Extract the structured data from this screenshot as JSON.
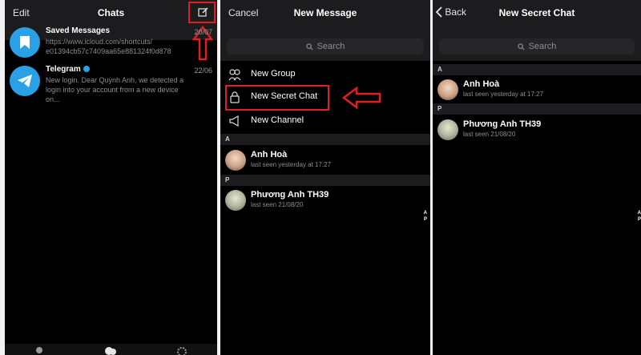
{
  "chats": {
    "edit_label": "Edit",
    "title": "Chats",
    "items": [
      {
        "title": "Saved Messages",
        "date": "20/07",
        "preview": "https://www.icloud.com/shortcuts/ e01394cb57c7409aa65e881324f0d878"
      },
      {
        "title": "Telegram",
        "date": "22/06",
        "preview": "New login. Dear Quỳnh Anh, we detected a login into your account from a new device on..."
      }
    ],
    "tabs": [
      "contacts-icon",
      "chats-icon",
      "settings-icon"
    ]
  },
  "new_message": {
    "cancel_label": "Cancel",
    "title": "New Message",
    "search_placeholder": "Search",
    "menu": [
      {
        "label": "New Group",
        "icon": "group-icon"
      },
      {
        "label": "New Secret Chat",
        "icon": "lock-icon"
      },
      {
        "label": "New Channel",
        "icon": "megaphone-icon"
      }
    ],
    "sections": [
      {
        "letter": "A",
        "contacts": [
          {
            "name": "Anh Hoà",
            "status": "last seen yesterday at 17:27"
          }
        ]
      },
      {
        "letter": "P",
        "contacts": [
          {
            "name": "Phương Anh TH39",
            "status": "last seen 21/08/20"
          }
        ]
      }
    ],
    "index": [
      "A",
      "P"
    ]
  },
  "secret_chat": {
    "back_label": "Back",
    "title": "New Secret Chat",
    "search_placeholder": "Search",
    "sections": [
      {
        "letter": "A",
        "contacts": [
          {
            "name": "Anh Hoà",
            "status": "last seen yesterday at 17:27"
          }
        ]
      },
      {
        "letter": "P",
        "contacts": [
          {
            "name": "Phương Anh TH39",
            "status": "last seen 21/08/20"
          }
        ]
      }
    ],
    "index": [
      "A",
      "P"
    ]
  },
  "colors": {
    "accent": "#2aa0e6",
    "highlight": "#e02020",
    "background": "#000000",
    "header": "#1c1c1e"
  }
}
